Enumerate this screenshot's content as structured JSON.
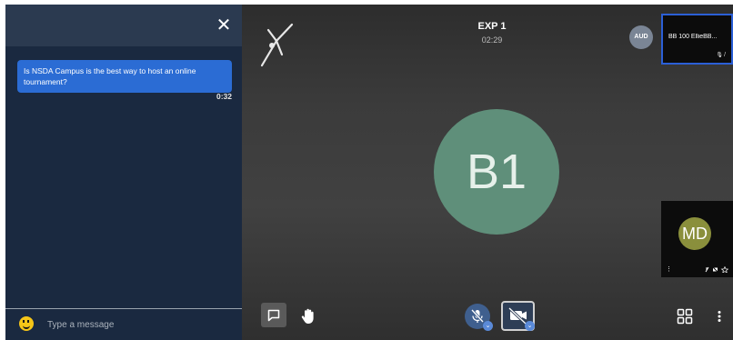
{
  "chat": {
    "close_icon": "✕",
    "messages": [
      {
        "text": "Is NSDA Campus is the best way to host an online tournament?",
        "time": "0:32"
      }
    ],
    "input": {
      "placeholder": "Type a message",
      "value": ""
    }
  },
  "room": {
    "title": "EXP 1",
    "timer": "02:29",
    "audience_badge": "AUD"
  },
  "participants": {
    "main_speaker": {
      "initials": "B1",
      "avatar_color": "#5f8f7a"
    },
    "tiles": [
      {
        "name": "BB 100 EllieBB...",
        "highlighted": true
      },
      {
        "initials": "MD",
        "avatar_color": "#8a8f3c",
        "menu_icon": "⋮"
      }
    ]
  },
  "toolbar": {
    "left": [
      "chat-toggle",
      "raise-hand"
    ],
    "center": [
      "mic-muted",
      "camera-off"
    ],
    "right": [
      "grid-view",
      "more-options"
    ]
  },
  "colors": {
    "chat_panel_bg": "#1a2940",
    "chat_header_bg": "#2b3a50",
    "message_bubble": "#2b6cd4",
    "active_tile_border": "#2b5fd6",
    "stage_bg": "#3a3a3a"
  }
}
